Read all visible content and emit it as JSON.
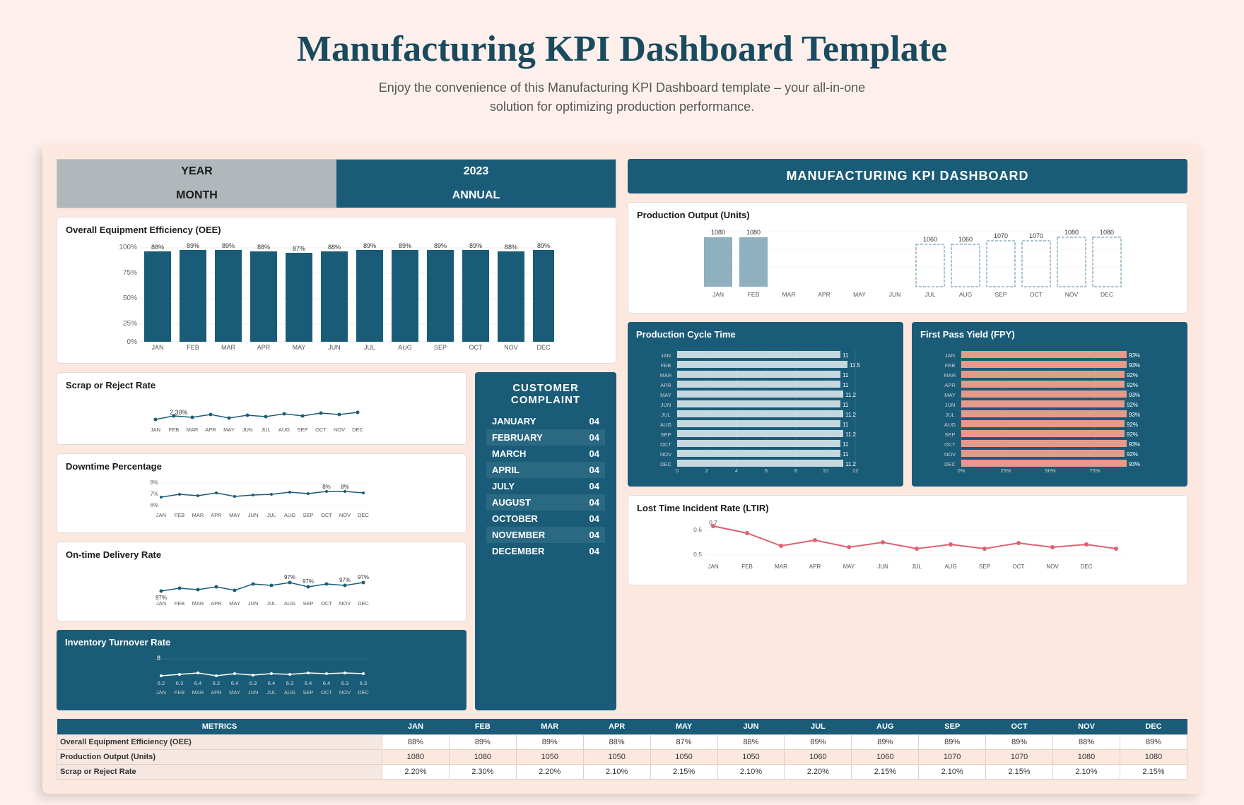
{
  "header": {
    "title": "Manufacturing KPI Dashboard Template",
    "subtitle": "Enjoy the convenience of this Manufacturing KPI Dashboard template – your all-in-one solution for optimizing production performance."
  },
  "selector": {
    "year_label": "YEAR",
    "year_value": "2023",
    "month_label": "MONTH",
    "month_value": "ANNUAL"
  },
  "kpi_title": "MANUFACTURING KPI DASHBOARD",
  "oee": {
    "title": "Overall Equipment Efficiency (OEE)",
    "months": [
      "JAN",
      "FEB",
      "MAR",
      "APR",
      "MAY",
      "JUN",
      "JUL",
      "AUG",
      "SEP",
      "OCT",
      "NOV",
      "DEC"
    ],
    "values": [
      88,
      89,
      89,
      88,
      87,
      88,
      89,
      89,
      89,
      89,
      88,
      89
    ],
    "y_labels": [
      "100%",
      "75%",
      "50%",
      "25%",
      "0%"
    ]
  },
  "production_output": {
    "title": "Production Output (Units)",
    "months": [
      "JAN",
      "FEB",
      "MAR",
      "APR",
      "MAY",
      "JUN",
      "JUL",
      "AUG",
      "SEP",
      "OCT",
      "NOV",
      "DEC"
    ],
    "values": [
      1080,
      1080,
      0,
      0,
      0,
      0,
      1060,
      1060,
      1070,
      1070,
      1080,
      1080
    ]
  },
  "scrap_rate": {
    "title": "Scrap or Reject Rate",
    "label_value": "2.30%",
    "months": [
      "JAN",
      "FEB",
      "MAR",
      "APR",
      "MAY",
      "JUN",
      "JUL",
      "AUG",
      "SEP",
      "OCT",
      "NOV",
      "DEC"
    ]
  },
  "downtime": {
    "title": "Downtime Percentage",
    "y_labels": [
      "8%",
      "7%",
      "6%"
    ],
    "months": [
      "JAN",
      "FEB",
      "MAR",
      "APR",
      "MAY",
      "JUN",
      "JUL",
      "AUG",
      "SEP",
      "OCT",
      "NOV",
      "DEC"
    ],
    "labels_shown": [
      "8%",
      "8%"
    ]
  },
  "delivery": {
    "title": "On-time Delivery Rate",
    "months": [
      "JAN",
      "FEB",
      "MAR",
      "APR",
      "MAY",
      "JUN",
      "JUL",
      "AUG",
      "SEP",
      "OCT",
      "NOV",
      "DEC"
    ],
    "values_shown": [
      "97%",
      "97%",
      "97%",
      "97%",
      "97%"
    ]
  },
  "inventory": {
    "title": "Inventory Turnover Rate",
    "y_label": "8",
    "months": [
      "JAN",
      "FEB",
      "MAR",
      "APR",
      "MAY",
      "JUN",
      "JUL",
      "AUG",
      "SEP",
      "OCT",
      "NOV",
      "DEC"
    ],
    "values": [
      "6.2",
      "6.3",
      "6.4",
      "6.2",
      "6.4",
      "6.3",
      "6.4",
      "6.3",
      "6.4",
      "6.4",
      "6.3"
    ]
  },
  "customer_complaint": {
    "title": "CUSTOMER COMPLAINT",
    "rows": [
      {
        "month": "JANUARY",
        "value": "04"
      },
      {
        "month": "FEBRUARY",
        "value": "04"
      },
      {
        "month": "MARCH",
        "value": "04"
      },
      {
        "month": "APRIL",
        "value": "04"
      },
      {
        "month": "JULY",
        "value": "04"
      },
      {
        "month": "AUGUST",
        "value": "04"
      },
      {
        "month": "OCTOBER",
        "value": "04"
      },
      {
        "month": "NOVEMBER",
        "value": "04"
      },
      {
        "month": "DECEMBER",
        "value": "04"
      }
    ]
  },
  "cycle_time": {
    "title": "Production Cycle Time",
    "months": [
      "JAN",
      "FEB",
      "MAR",
      "APR",
      "MAY",
      "JUN",
      "JUL",
      "AUG",
      "SEP",
      "OCT",
      "NOV",
      "DEC"
    ],
    "values": [
      11,
      11.5,
      11,
      11,
      11.2,
      11,
      11.2,
      11,
      11.2,
      11,
      11,
      11.2
    ],
    "x_labels": [
      "0",
      "2",
      "4",
      "6",
      "8",
      "10",
      "12"
    ]
  },
  "fpy": {
    "title": "First Pass Yield (FPY)",
    "months": [
      "JAN",
      "FEB",
      "MAR",
      "APR",
      "MAY",
      "JUN",
      "JUL",
      "AUG",
      "SEP",
      "OCT",
      "NOV",
      "DEC"
    ],
    "values": [
      93,
      93,
      92,
      92,
      93,
      92,
      93,
      92,
      92,
      93,
      92,
      93
    ],
    "x_labels": [
      "0%",
      "25%",
      "50%",
      "75%"
    ]
  },
  "ltir": {
    "title": "Lost Time Incident Rate (LTIR)",
    "months": [
      "JAN",
      "FEB",
      "MAR",
      "APR",
      "MAY",
      "JUN",
      "JUL",
      "AUG",
      "SEP",
      "OCT",
      "NOV",
      "DEC"
    ],
    "y_labels": [
      "0.6",
      "0.5"
    ],
    "peak_value": "0.7"
  },
  "bottom_table": {
    "headers": [
      "METRICS",
      "JAN",
      "FEB",
      "MAR",
      "APR",
      "MAY",
      "JUN",
      "JUL",
      "AUG",
      "SEP",
      "OCT",
      "NOV",
      "DEC"
    ],
    "rows": [
      {
        "metric": "Overall Equipment Efficiency (OEE)",
        "values": [
          "88%",
          "89%",
          "89%",
          "88%",
          "87%",
          "88%",
          "89%",
          "89%",
          "89%",
          "89%",
          "88%",
          "89%"
        ]
      },
      {
        "metric": "Production Output (Units)",
        "values": [
          "1080",
          "1080",
          "1050",
          "1050",
          "1050",
          "1050",
          "1060",
          "1060",
          "1070",
          "1070",
          "1080",
          "1080"
        ]
      },
      {
        "metric": "Scrap or Reject Rate",
        "values": [
          "2.20%",
          "2.30%",
          "2.20%",
          "2.10%",
          "2.15%",
          "2.10%",
          "2.20%",
          "2.15%",
          "2.10%",
          "2.15%",
          "2.10%",
          "2.15%"
        ]
      }
    ]
  }
}
